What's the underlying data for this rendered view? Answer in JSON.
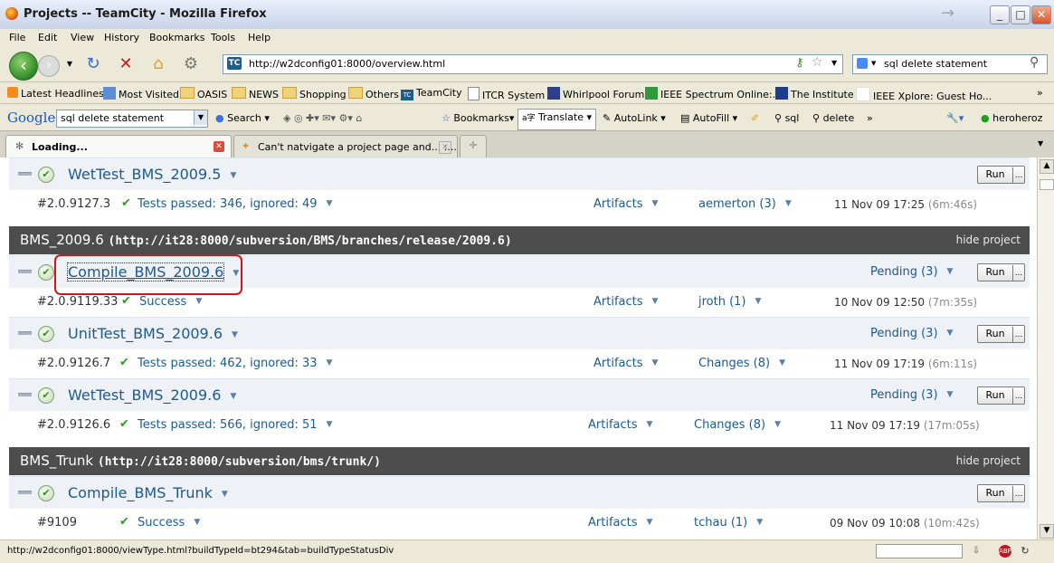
{
  "window": {
    "title": "Projects -- TeamCity - Mozilla Firefox"
  },
  "menu": [
    "File",
    "Edit",
    "View",
    "History",
    "Bookmarks",
    "Tools",
    "Help"
  ],
  "nav": {
    "url": "http://w2dconfig01:8000/overview.html",
    "search_text": "sql delete statement"
  },
  "bookmarks": [
    "Latest Headlines",
    "Most Visited",
    "OASIS",
    "NEWS",
    "Shopping",
    "Others",
    "TeamCity",
    "ITCR System",
    "Whirlpool Forums",
    "IEEE Spectrum Online:...",
    "The Institute",
    "IEEE Xplore: Guest Ho..."
  ],
  "google_toolbar": {
    "logo": "Google",
    "query": "sql delete statement",
    "search": "Search",
    "bookmarks": "Bookmarks",
    "translate": "Translate",
    "autolink": "AutoLink",
    "autofill": "AutoFill",
    "sql": "sql",
    "delete": "delete",
    "more": "»",
    "user": "heroheroz"
  },
  "tabs": [
    {
      "label": "Loading..."
    },
    {
      "label": "Can't natvigate a project page and... :..."
    }
  ],
  "common": {
    "run": "Run",
    "more": "...",
    "artifacts": "Artifacts",
    "hide_project": "hide project"
  },
  "projects": {
    "p2009_6": {
      "name": "BMS_2009.6",
      "url": "(http://it28:8000/subversion/BMS/branches/release/2009.6)"
    },
    "trunk": {
      "name": "BMS_Trunk",
      "url": "(http://it28:8000/subversion/bms/trunk/)"
    }
  },
  "buildtypes": {
    "wet2009_5": {
      "name": "WetTest_BMS_2009.5",
      "number": "#2.0.9127.3",
      "status": "Tests passed: 346, ignored: 49",
      "changes": "aemerton (3)",
      "date": "11 Nov 09 17:25",
      "duration": "(6m:46s)"
    },
    "compile2009_6": {
      "name": "Compile_BMS_2009.6",
      "pending": "Pending (3)",
      "number": "#2.0.9119.33",
      "status": "Success",
      "changes": "jroth (1)",
      "date": "10 Nov 09 12:50",
      "duration": "(7m:35s)"
    },
    "unit2009_6": {
      "name": "UnitTest_BMS_2009.6",
      "pending": "Pending (3)",
      "number": "#2.0.9126.7",
      "status": "Tests passed: 462, ignored: 33",
      "changes": "Changes (8)",
      "date": "11 Nov 09 17:19",
      "duration": "(6m:11s)"
    },
    "wet2009_6": {
      "name": "WetTest_BMS_2009.6",
      "pending": "Pending (3)",
      "number": "#2.0.9126.6",
      "status": "Tests passed: 566, ignored: 51",
      "changes": "Changes (8)",
      "date": "11 Nov 09 17:19",
      "duration": "(17m:05s)"
    },
    "compileTrunk": {
      "name": "Compile_BMS_Trunk",
      "number": "#9109",
      "status": "Success",
      "changes": "tchau (1)",
      "date": "09 Nov 09 10:08",
      "duration": "(10m:42s)"
    }
  },
  "statusbar": {
    "text": "http://w2dconfig01:8000/viewType.html?buildTypeId=bt294&tab=buildTypeStatusDiv"
  }
}
